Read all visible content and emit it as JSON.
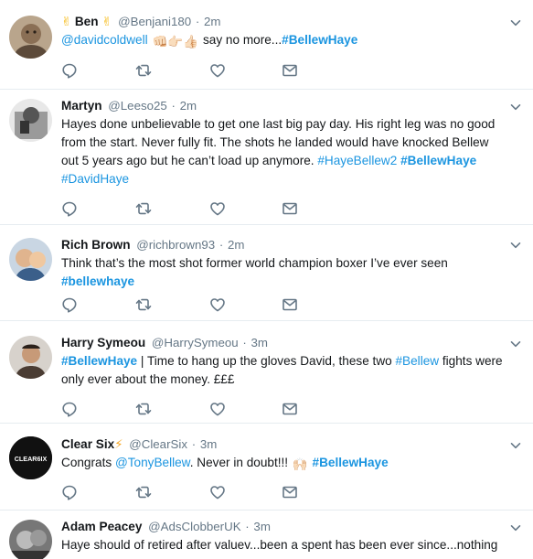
{
  "tweets": [
    {
      "name_emoji_left": "✌",
      "name": "Ben",
      "name_emoji_right": "✌",
      "handle": "@Benjani180",
      "sep": "·",
      "time": "2m",
      "text": {
        "mention": "@davidcoldwell",
        "emojis": "👊🏻👉🏻👍🏻",
        "plain": "say no more...",
        "hashtag": "#BellewHaye"
      }
    },
    {
      "name": "Martyn",
      "handle": "@Leeso25",
      "sep": "·",
      "time": "2m",
      "text": {
        "line1": "Hayes done unbelievable to get one last big pay day. His right leg was no good",
        "line2": "from the start. Never fully fit.  The shots he landed would have knocked Bellew",
        "line3": "out 5 years ago but he can’t load up anymore.",
        "hashtag1": "#HayeBellew2",
        "hashtag2": "#BellewHaye",
        "hashtag3": "#DavidHaye"
      }
    },
    {
      "name": "Rich Brown",
      "handle": "@richbrown93",
      "sep": "·",
      "time": "2m",
      "text": {
        "line1": "Think that’s the most shot former world champion boxer I’ve ever seen",
        "hashtag": "#bellewhaye"
      }
    },
    {
      "name": "Harry Symeou",
      "handle": "@HarrySymeou",
      "sep": "·",
      "time": "3m",
      "text": {
        "hashtag1": "#BellewHaye",
        "middle": " | Time to hang up the gloves David, these two ",
        "hashtag2": "#Bellew",
        "end1": " fights were",
        "line2": "only ever about the money. £££"
      }
    },
    {
      "name": "Clear Six",
      "name_emoji_right": "⚡",
      "handle": "@ClearSix",
      "sep": "·",
      "time": "3m",
      "avatar_text": "CLEAR6IX",
      "text": {
        "plain": "Congrats ",
        "mention": "@TonyBellew",
        "plain2": ". Never in doubt!!!",
        "emoji": "🙌🏻",
        "hashtag": "#BellewHaye"
      }
    },
    {
      "name": "Adam Peacey",
      "handle": "@AdsClobberUK",
      "sep": "·",
      "time": "3m",
      "text": {
        "line1": "Haye should of retired after valuev...been a spent has been ever since...nothing"
      }
    }
  ],
  "icons": {
    "reply": "reply-icon",
    "retweet": "retweet-icon",
    "like": "heart-icon",
    "message": "envelope-icon",
    "menu": "chevron-down-icon"
  },
  "colors": {
    "link": "#1b95e0",
    "meta": "#657786",
    "text": "#14171a",
    "divider": "#e6ecf0",
    "icon": "#657786"
  }
}
